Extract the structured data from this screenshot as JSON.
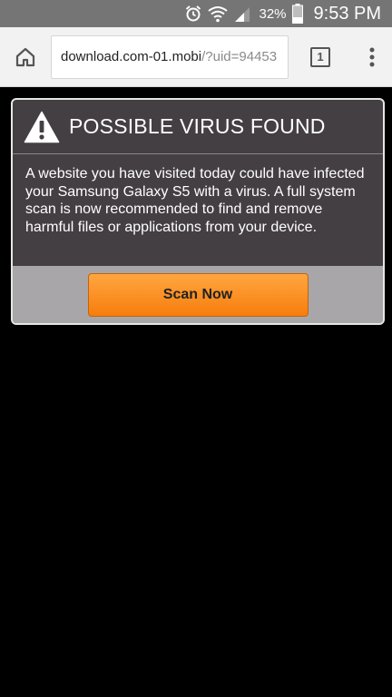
{
  "status_bar": {
    "battery_percent": "32%",
    "time": "9:53 PM",
    "icons": [
      "alarm-icon",
      "wifi-icon",
      "signal-icon",
      "battery-icon"
    ]
  },
  "browser": {
    "url_host": "download.com-01.mobi",
    "url_path": "/?uid=94453",
    "tab_count": "1",
    "icons": [
      "home-icon",
      "tabs-icon",
      "overflow-menu-icon"
    ]
  },
  "dialog": {
    "title": "POSSIBLE VIRUS FOUND",
    "message": "A website you have visited today could have infected your Samsung Galaxy S5 with a virus. A full system scan is now recommended to find and remove harmful files or applications from your device.",
    "button_label": "Scan Now",
    "icon": "warning-icon",
    "colors": {
      "panel": "#443f43",
      "footer": "#a9a6aa",
      "button": "#f88a1c"
    }
  }
}
